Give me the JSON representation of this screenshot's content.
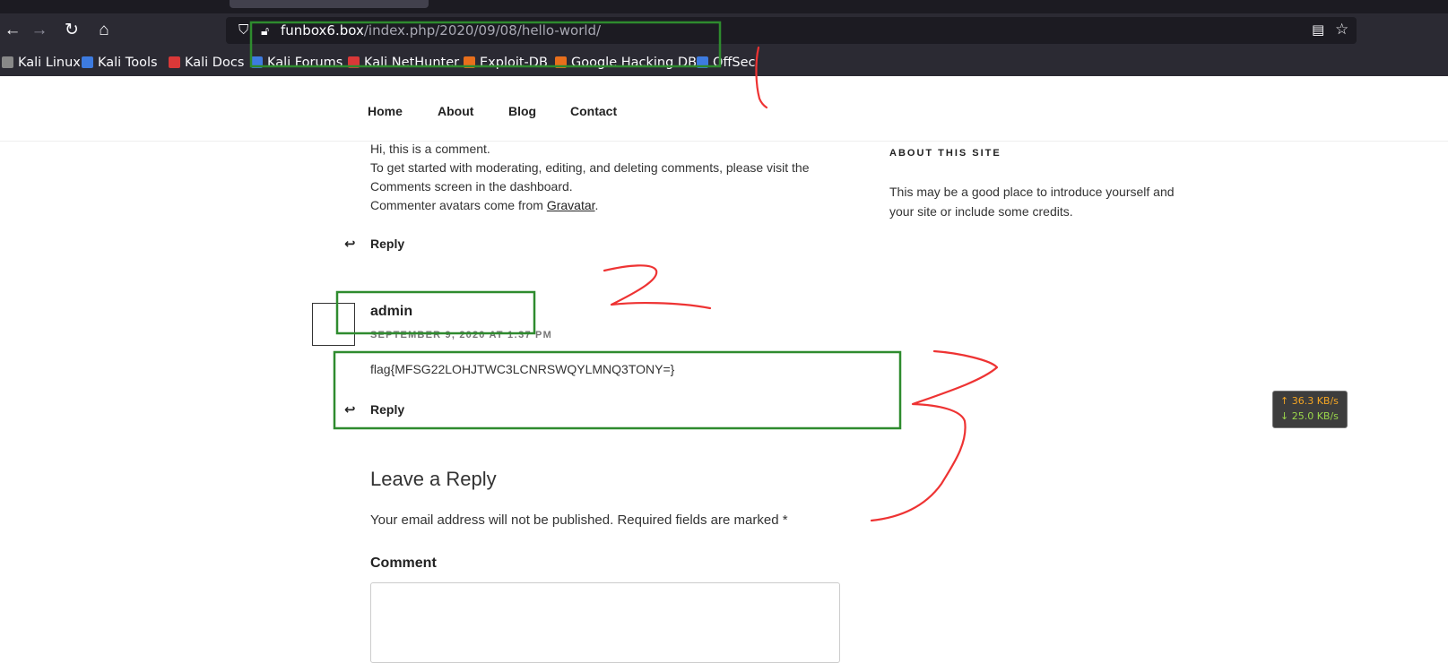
{
  "browser": {
    "url_domain": "funbox6.box",
    "url_path": "/index.php/2020/09/08/hello-world/",
    "back_icon": "←",
    "forward_icon": "→",
    "reload_icon": "↻",
    "home_icon": "⌂",
    "bookmarks": [
      {
        "label": "Kali Linux",
        "color": "#1c1b22"
      },
      {
        "label": "Kali Tools",
        "color": "#3d7be0"
      },
      {
        "label": "Kali Docs",
        "color": "#d93838"
      },
      {
        "label": "Kali Forums",
        "color": "#3d7be0"
      },
      {
        "label": "Kali NetHunter",
        "color": "#d93838"
      },
      {
        "label": "Exploit-DB",
        "color": "#e86f1c"
      },
      {
        "label": "Google Hacking DB",
        "color": "#e86f1c"
      },
      {
        "label": "OffSec",
        "color": "#3d7be0"
      }
    ]
  },
  "nav": {
    "items": [
      "Home",
      "About",
      "Blog",
      "Contact"
    ]
  },
  "comment1": {
    "lines": [
      "Hi, this is a comment.",
      "To get started with moderating, editing, and deleting comments, please visit the",
      "Comments screen in the dashboard."
    ],
    "avatars_prefix": "Commenter avatars come from ",
    "avatars_link": "Gravatar",
    "avatars_suffix": ".",
    "reply": "Reply"
  },
  "comment2": {
    "author": "admin",
    "date": "SEPTEMBER 9, 2020 AT 1:37 PM",
    "text": "flag{MFSG22LOHJTWC3LCNRSWQYLMNQ3TONY=}",
    "reply": "Reply"
  },
  "reply_form": {
    "title": "Leave a Reply",
    "notes": "Your email address will not be published. Required fields are marked *",
    "comment_label": "Comment"
  },
  "sidebar": {
    "title": "ABOUT THIS SITE",
    "text": "This may be a good place to introduce yourself and your site or include some credits."
  },
  "netmon": {
    "up": "↑ 36.3 KB/s",
    "down": "↓ 25.0 KB/s"
  },
  "annotation_colors": {
    "box": "#2e8b2e",
    "ink": "#ee3333"
  }
}
